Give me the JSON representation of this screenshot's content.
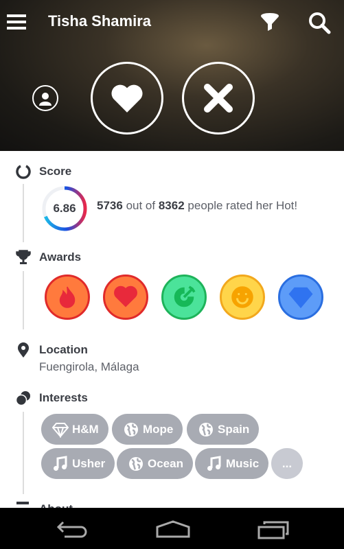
{
  "header": {
    "title": "Tisha Shamira",
    "icons": [
      "menu-icon",
      "filter-icon",
      "search-icon",
      "profile-icon",
      "heart-icon",
      "close-icon"
    ]
  },
  "score": {
    "heading": "Score",
    "value": "6.86",
    "fraction": 0.686,
    "hot_count": "5736",
    "mid": "out of",
    "total": "8362",
    "suffix": "people rated her Hot!"
  },
  "awards": {
    "heading": "Awards",
    "items": [
      {
        "icon": "fire-icon",
        "fill": "#ff7a3d",
        "border": "#e02a2a",
        "glyph": "#e8293b"
      },
      {
        "icon": "heart-icon",
        "fill": "#ff7a3d",
        "border": "#e02a2a",
        "glyph": "#e8293b"
      },
      {
        "icon": "target-icon",
        "fill": "#4be39a",
        "border": "#1eb35a",
        "glyph": "#16b858"
      },
      {
        "icon": "smiley-icon",
        "fill": "#ffd54a",
        "border": "#f2a81d",
        "glyph": "#f7a300"
      },
      {
        "icon": "diamond-icon",
        "fill": "#5d9cf8",
        "border": "#2a6ee0",
        "glyph": "#2f73f0"
      }
    ]
  },
  "location": {
    "heading": "Location",
    "value": "Fuengirola, Málaga"
  },
  "interests": {
    "heading": "Interests",
    "items": [
      {
        "label": "H&M",
        "icon": "diamond-icon"
      },
      {
        "label": "Mope",
        "icon": "globe-icon"
      },
      {
        "label": "Spain",
        "icon": "globe-icon"
      },
      {
        "label": "Usher",
        "icon": "music-icon"
      },
      {
        "label": "Ocean",
        "icon": "globe-icon"
      },
      {
        "label": "Music",
        "icon": "music-icon"
      }
    ],
    "more": "..."
  },
  "about": {
    "heading": "About"
  }
}
